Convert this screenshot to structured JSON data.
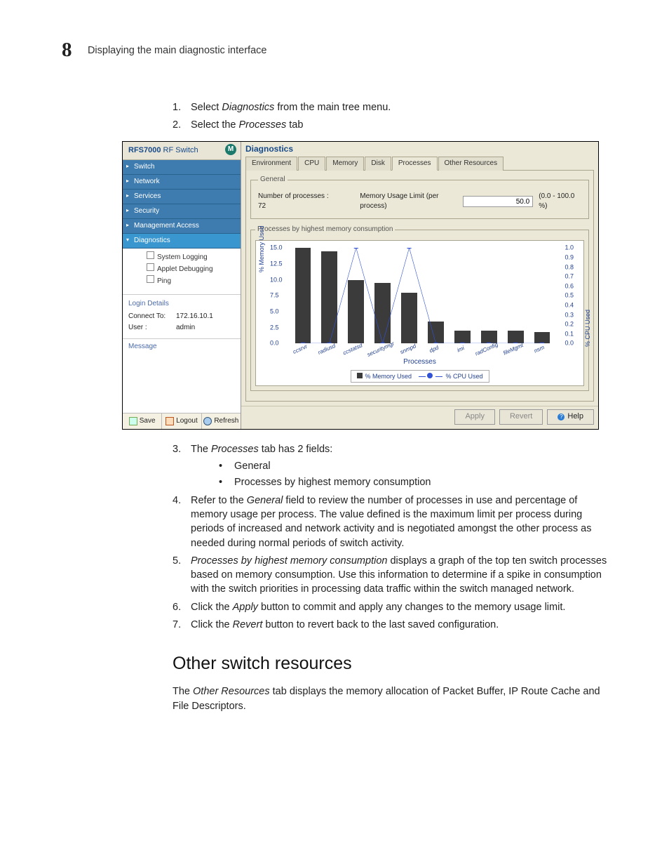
{
  "header": {
    "chapter_number": "8",
    "title": "Displaying the main diagnostic interface"
  },
  "steps_top": [
    {
      "n": "1.",
      "html": "Select <i>Diagnostics</i> from the main tree menu."
    },
    {
      "n": "2.",
      "html": "Select the <i>Processes</i> tab"
    }
  ],
  "screenshot": {
    "sidebar": {
      "product_bold": "RFS7000",
      "product_rest": " RF Switch",
      "logo_letter": "M",
      "items": [
        {
          "label": "Switch",
          "open": false
        },
        {
          "label": "Network",
          "open": false
        },
        {
          "label": "Services",
          "open": false
        },
        {
          "label": "Security",
          "open": false
        },
        {
          "label": "Management Access",
          "open": false
        },
        {
          "label": "Diagnostics",
          "open": true
        }
      ],
      "diag_children": [
        "System Logging",
        "Applet Debugging",
        "Ping"
      ],
      "login": {
        "legend": "Login Details",
        "connect_label": "Connect To:",
        "connect_val": "172.16.10.1",
        "user_label": "User :",
        "user_val": "admin"
      },
      "message_legend": "Message",
      "footer": {
        "save": "Save",
        "logout": "Logout",
        "refresh": "Refresh"
      }
    },
    "main": {
      "title": "Diagnostics",
      "tabs": [
        "Environment",
        "CPU",
        "Memory",
        "Disk",
        "Processes",
        "Other Resources"
      ],
      "active_tab_index": 4,
      "general": {
        "legend": "General",
        "num_label": "Number of processes : 72",
        "mem_limit_label": "Memory Usage Limit (per process)",
        "mem_limit_value": "50.0",
        "mem_limit_range": "(0.0 - 100.0 %)"
      },
      "chart_panel_legend": "Processes by highest memory consumption",
      "footer": {
        "apply": "Apply",
        "revert": "Revert",
        "help": "Help"
      }
    }
  },
  "chart_data": {
    "type": "bar",
    "title": "",
    "xlabel": "Processes",
    "ylabel": "% Memory Used",
    "y2label": "% CPU Used",
    "ylim": [
      0.0,
      15.0
    ],
    "y2lim": [
      0.0,
      1.0
    ],
    "yticks": [
      0.0,
      2.5,
      5.0,
      7.5,
      10.0,
      12.5,
      15.0
    ],
    "y2ticks": [
      0.0,
      0.1,
      0.2,
      0.3,
      0.4,
      0.5,
      0.6,
      0.7,
      0.8,
      0.9,
      1.0
    ],
    "categories": [
      "ccsrvr",
      "radiusd",
      "ccstatsd",
      "securitymgr",
      "snmpd",
      "dpd",
      "imi",
      "radConfig",
      "fileMgmt",
      "nsm"
    ],
    "series": [
      {
        "name": "% Memory Used",
        "axis": "left",
        "kind": "bar",
        "values": [
          15.0,
          14.5,
          10.0,
          9.5,
          8.0,
          3.5,
          2.0,
          2.0,
          2.0,
          1.8
        ]
      },
      {
        "name": "% CPU Used",
        "axis": "right",
        "kind": "line",
        "values": [
          0.0,
          0.0,
          1.0,
          0.0,
          1.0,
          0.0,
          0.0,
          0.0,
          0.0,
          0.0
        ]
      }
    ],
    "legend": [
      "% Memory Used",
      "% CPU Used"
    ]
  },
  "steps_bottom": [
    {
      "n": "3.",
      "html": "The <i>Processes</i> tab has 2 fields:",
      "bullets": [
        "General",
        "Processes by highest memory consumption"
      ]
    },
    {
      "n": "4.",
      "html": "Refer to the <i>General</i> field to review the number of processes in use and percentage of memory usage per process. The value defined is the maximum limit per process during periods of increased and network activity and is negotiated amongst the other process as needed during normal periods of switch activity."
    },
    {
      "n": "5.",
      "html": "<i>Processes by highest memory consumption</i> displays a graph of the top ten switch processes based on memory consumption. Use this information to determine if a spike in consumption with the switch priorities in processing data traffic within the switch managed network."
    },
    {
      "n": "6.",
      "html": "Click the <i>Apply</i> button to commit and apply any changes to the memory usage limit."
    },
    {
      "n": "7.",
      "html": "Click the <i>Revert</i> button to revert back to the last saved configuration."
    }
  ],
  "section2": {
    "heading": "Other switch resources",
    "para_html": "The <i>Other Resources</i> tab displays the memory allocation of Packet Buffer, IP Route Cache and File Descriptors."
  }
}
